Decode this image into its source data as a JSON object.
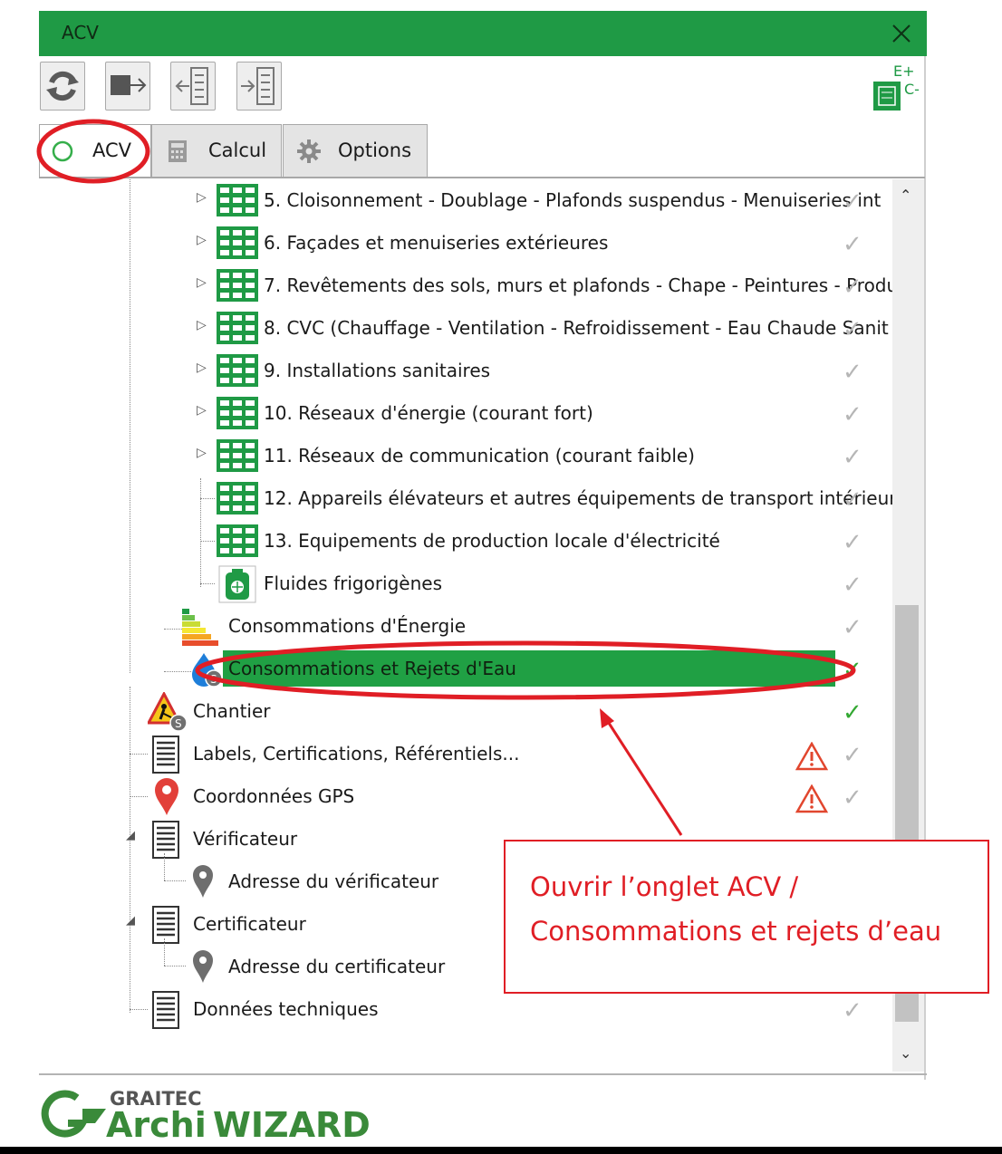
{
  "window": {
    "title": "ACV"
  },
  "colors": {
    "accent": "#1f9a45",
    "selection": "#20a044",
    "annotation": "#e01e25",
    "check": "#b6b6b6",
    "check_active": "#33a832",
    "warning": "#e1462e"
  },
  "toolbar": {
    "buttons": [
      "refresh-icon",
      "export-icon",
      "import-icon",
      "import-alt-icon"
    ],
    "ec_logo": {
      "top": "E+",
      "side": "C-"
    }
  },
  "tabs": [
    {
      "label": "ACV",
      "icon": "circle-icon",
      "active": true
    },
    {
      "label": "Calcul",
      "icon": "calculator-icon"
    },
    {
      "label": "Options",
      "icon": "gear-icon"
    }
  ],
  "tree": {
    "lots": [
      "5. Cloisonnement - Doublage - Plafonds suspendus - Menuiseries int",
      "6. Façades et menuiseries extérieures",
      "7. Revêtements des sols, murs et plafonds - Chape - Peintures - Produ",
      "8. CVC (Chauffage - Ventilation - Refroidissement - Eau Chaude Sanit",
      "9. Installations sanitaires",
      "10. Réseaux d'énergie (courant fort)",
      "11. Réseaux de communication (courant faible)",
      "12. Appareils élévateurs et autres équipements de transport intérieur",
      "13. Equipements de production locale d'électricité"
    ],
    "fluides": "Fluides frigorigènes",
    "energie": "Consommations d'Énergie",
    "eau": "Consommations et Rejets d'Eau",
    "chantier": "Chantier",
    "labels": "Labels, Certifications, Référentiels...",
    "gps": "Coordonnées GPS",
    "verificateur": "Vérificateur",
    "adresse_verificateur": "Adresse du vérificateur",
    "certificateur": "Certificateur",
    "adresse_certificateur": "Adresse du certificateur",
    "donnees": "Données techniques"
  },
  "brand": {
    "company": "GRAITEC",
    "product_a": "Archi",
    "product_b": "WIZARD"
  },
  "annotation": {
    "line1": "Ouvrir l’onglet ACV /",
    "line2": "Consommations et rejets d’eau"
  }
}
